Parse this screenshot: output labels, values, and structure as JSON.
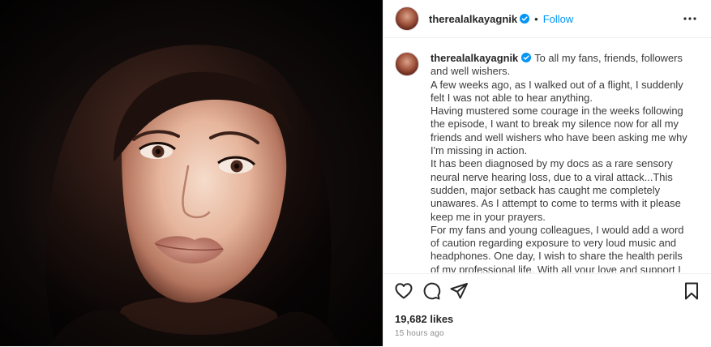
{
  "post": {
    "username": "therealalkayagnik",
    "header_separator": "•",
    "follow_label": "Follow",
    "caption": {
      "username": "therealalkayagnik",
      "lines": [
        "To all my fans, friends, followers and well wishers.",
        "A few weeks ago, as I walked out of a flight, I suddenly felt I was not able to hear anything.",
        "Having mustered some courage in the weeks following the episode, I want to break my silence now for all my friends and well wishers who have been asking me why I'm missing in action.",
        "It has been diagnosed by my docs as a rare sensory neural nerve hearing loss, due to a viral attack...This sudden, major setback has caught me completely unawares. As I attempt to come to terms with it please keep me in your prayers.",
        "For my fans and young colleagues, I would add a word of caution regarding exposure to very loud music and headphones. One day, I wish to share the health perils of my professional life. With all your love and support I am hoping to recalibrate my life and come back to you soon."
      ]
    },
    "likes": "19,682 likes",
    "time_ago": "15 hours ago"
  },
  "icons": {
    "verified": "verified-badge-icon",
    "more": "more-options-icon",
    "like": "heart-icon",
    "comment": "comment-icon",
    "share": "share-icon",
    "save": "bookmark-icon"
  },
  "colors": {
    "accent": "#0095f6",
    "text": "#262626",
    "muted": "#8e8e8e",
    "border": "#efefef"
  }
}
